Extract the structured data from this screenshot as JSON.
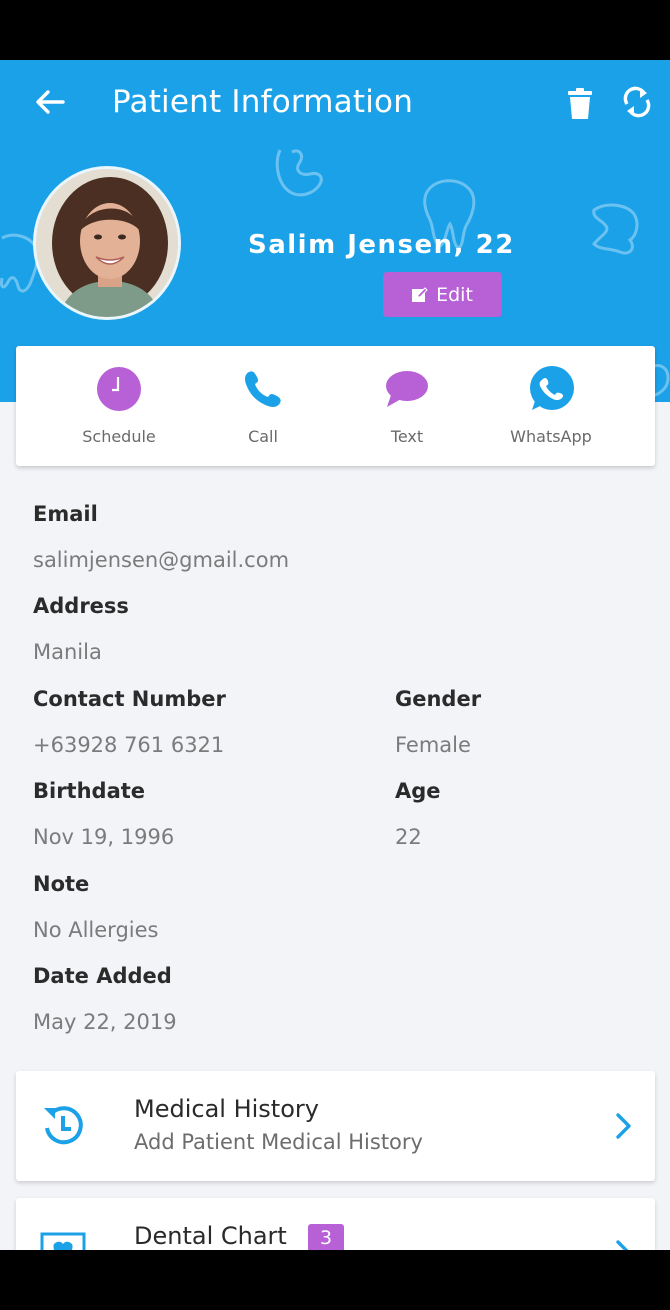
{
  "header": {
    "title": "Patient Information",
    "patient_name": "Salim Jensen, 22",
    "edit_label": "Edit"
  },
  "actions": [
    {
      "label": "Schedule",
      "icon": "clock-icon"
    },
    {
      "label": "Call",
      "icon": "phone-icon"
    },
    {
      "label": "Text",
      "icon": "chat-bubble-icon"
    },
    {
      "label": "WhatsApp",
      "icon": "whatsapp-icon"
    }
  ],
  "details": {
    "email_label": "Email",
    "email_value": "salimjensen@gmail.com",
    "address_label": "Address",
    "address_value": "Manila",
    "contact_label": "Contact Number",
    "contact_value": "+63928 761 6321",
    "gender_label": "Gender",
    "gender_value": "Female",
    "birthdate_label": "Birthdate",
    "birthdate_value": "Nov 19, 1996",
    "age_label": "Age",
    "age_value": "22",
    "note_label": "Note",
    "note_value": "No Allergies",
    "date_added_label": "Date Added",
    "date_added_value": "May 22, 2019"
  },
  "sections": [
    {
      "title": "Medical History",
      "subtitle": "Add Patient Medical History",
      "icon": "history-icon"
    },
    {
      "title": "Dental Chart",
      "badge": "3",
      "icon": "tooth-chart-icon"
    }
  ],
  "colors": {
    "primary": "#1ba1e8",
    "accent": "#b860d6",
    "background": "#f2f4f8"
  }
}
